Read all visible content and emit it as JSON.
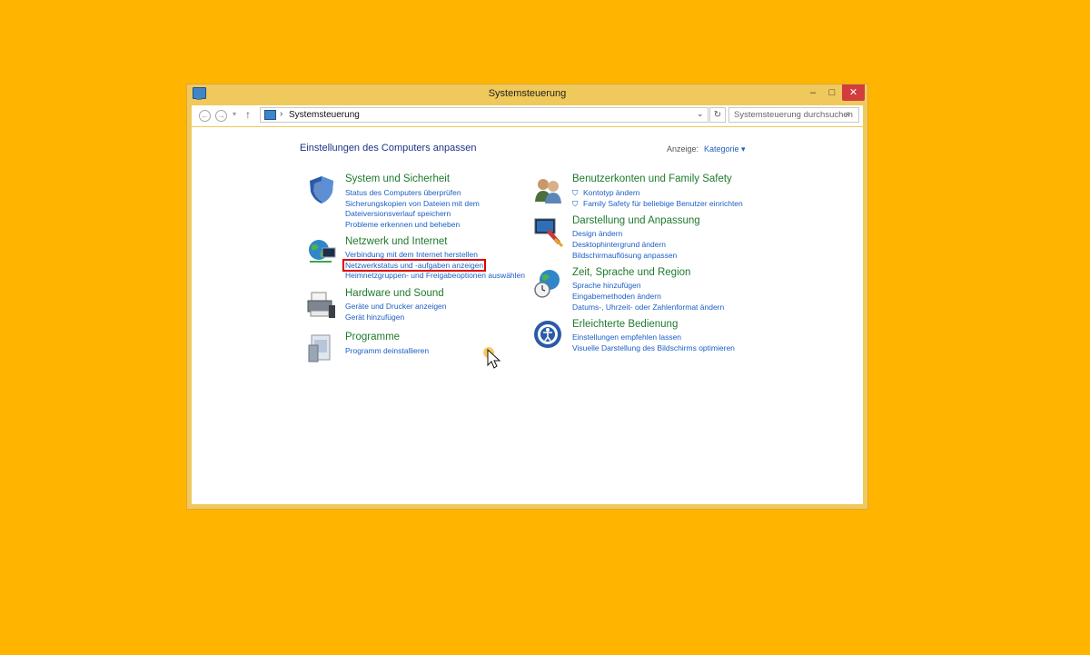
{
  "window": {
    "title": "Systemsteuerung",
    "buttons": {
      "minimize": "–",
      "maximize": "□",
      "close": "✕"
    }
  },
  "navbar": {
    "back": "←",
    "forward": "→",
    "history": "▾",
    "up": "↑",
    "breadcrumb_sep": "›",
    "address": "Systemsteuerung",
    "address_dropdown": "⌄",
    "refresh": "↻",
    "search_placeholder": "Systemsteuerung durchsuchen",
    "search_icon": "⌕"
  },
  "content": {
    "heading": "Einstellungen des Computers anpassen",
    "view_label": "Anzeige:",
    "view_value": "Kategorie ▾"
  },
  "categories": {
    "system": {
      "title": "System und Sicherheit",
      "links": [
        "Status des Computers überprüfen",
        "Sicherungskopien von Dateien mit dem",
        "Dateiversionsverlauf speichern",
        "Probleme erkennen und beheben"
      ]
    },
    "network": {
      "title": "Netzwerk und Internet",
      "links": [
        "Verbindung mit dem Internet herstellen",
        "Netzwerkstatus und -aufgaben anzeigen",
        "Heimnetzgruppen- und Freigabeoptionen auswählen"
      ]
    },
    "hardware": {
      "title": "Hardware und Sound",
      "links": [
        "Geräte und Drucker anzeigen",
        "Gerät hinzufügen"
      ]
    },
    "programs": {
      "title": "Programme",
      "links": [
        "Programm deinstallieren"
      ]
    },
    "accounts": {
      "title": "Benutzerkonten und Family Safety",
      "links": [
        "Kontotyp ändern",
        "Family Safety für beliebige Benutzer einrichten"
      ]
    },
    "appearance": {
      "title": "Darstellung und Anpassung",
      "links": [
        "Design ändern",
        "Desktophintergrund ändern",
        "Bildschirmauflösung anpassen"
      ]
    },
    "clock": {
      "title": "Zeit, Sprache und Region",
      "links": [
        "Sprache hinzufügen",
        "Eingabemethoden ändern",
        "Datums-, Uhrzeit- oder Zahlenformat ändern"
      ]
    },
    "ease": {
      "title": "Erleichterte Bedienung",
      "links": [
        "Einstellungen empfehlen lassen",
        "Visuelle Darstellung des Bildschirms optimieren"
      ]
    }
  },
  "colors": {
    "desktop": "#ffb400",
    "window_frame": "#f0c95c",
    "category_title": "#1f7a2d",
    "link": "#1b5fc4",
    "highlight_border": "#e00000"
  }
}
